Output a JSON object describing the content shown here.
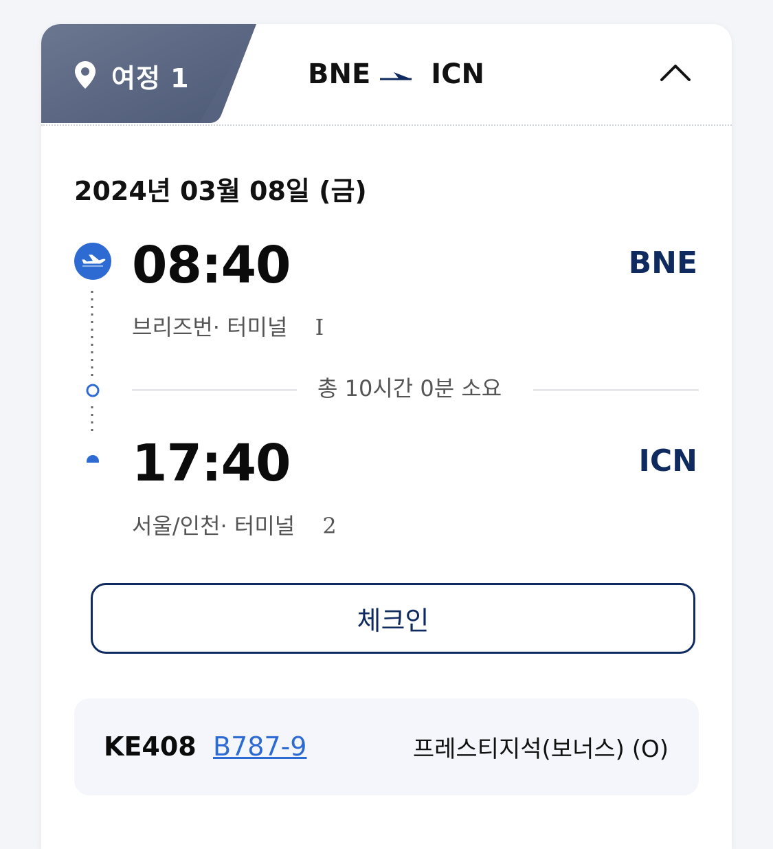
{
  "header": {
    "tab_label": "여정 1",
    "route_from": "BNE",
    "route_to": "ICN",
    "tab_color": "#5e6a85"
  },
  "date": "2024년 03월 08일 (금)",
  "departure": {
    "time": "08:40",
    "code": "BNE",
    "location": "브리즈번· 터미널",
    "terminal": "I"
  },
  "duration": "총 10시간 0분 소요",
  "arrival": {
    "time": "17:40",
    "code": "ICN",
    "location": "서울/인천· 터미널",
    "terminal": "2"
  },
  "checkin_label": "체크인",
  "flight": {
    "number": "KE408",
    "aircraft": "B787-9",
    "seat_class": "프레스티지석(보너스) (O)"
  },
  "colors": {
    "accent_blue": "#2d6bd3",
    "navy": "#0e2a5e"
  }
}
